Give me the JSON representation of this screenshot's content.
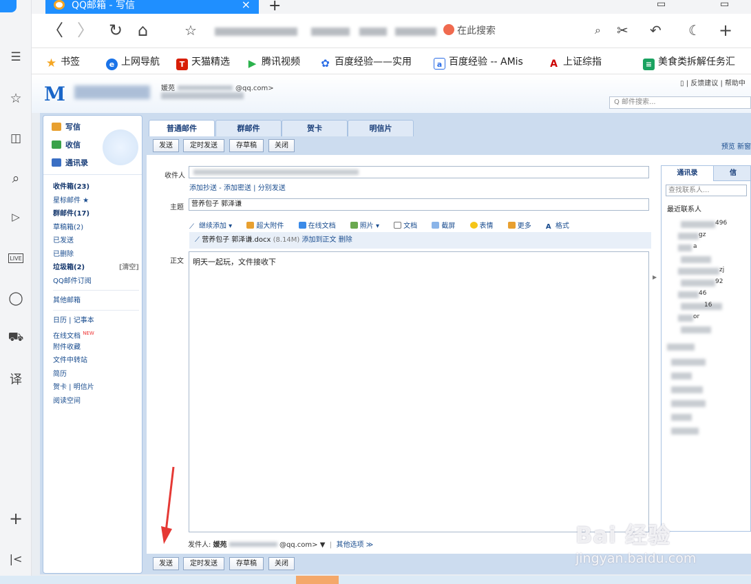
{
  "browser": {
    "tab_title": "QQ邮箱 - 写信",
    "tab_close": "×",
    "new_tab": "+",
    "search_hint": "在此搜索",
    "nav": {
      "back": "〈",
      "forward": "〉",
      "reload": "↻",
      "home": "⌂",
      "star": "☆",
      "search": "⌕",
      "cut": "✂",
      "undo": "↶",
      "moon": "☾",
      "plus": "+"
    }
  },
  "rail": {
    "items": [
      "≡",
      "☆",
      "📖",
      "⌕",
      "▷",
      "LIVE",
      "◯",
      "🛒",
      "译",
      "+",
      "|<"
    ]
  },
  "bookmarks": {
    "items": [
      {
        "label": "书签",
        "icon": "star",
        "color": "#f5a623",
        "glyph": "★"
      },
      {
        "label": "上网导航",
        "icon": "ie",
        "color": "#1a73e8",
        "glyph": "e"
      },
      {
        "label": "天猫精选",
        "icon": "tmall",
        "color": "#d81e06",
        "glyph": "T"
      },
      {
        "label": "腾讯视频",
        "icon": "video",
        "color": "#2bb24c",
        "glyph": "▶"
      },
      {
        "label": "百度经验——实用",
        "icon": "baidu",
        "color": "#2b6de6",
        "glyph": "✿"
      },
      {
        "label": "百度经验 -- AMis",
        "icon": "a",
        "color": "#2b6de6",
        "glyph": "a"
      },
      {
        "label": "上证综指",
        "icon": "stock",
        "color": "#c00",
        "glyph": "A"
      },
      {
        "label": "美食类拆解任务汇",
        "icon": "sheet",
        "color": "#1aa260",
        "glyph": "≡"
      }
    ]
  },
  "mail_header": {
    "logo": "M",
    "account_line": "媛苑",
    "account_email": "@qq.com>",
    "top_links": "▯ | 反馈建议 | 帮助中",
    "search_placeholder": "Q 邮件搜索..."
  },
  "sidebar": {
    "top": [
      {
        "label": "写信",
        "color": "#e8a030"
      },
      {
        "label": "收信",
        "color": "#3aa24a"
      },
      {
        "label": "通讯录",
        "color": "#3a6fc4"
      }
    ],
    "items": [
      {
        "label": "收件箱(23)",
        "bold": true
      },
      {
        "label": "星标邮件 ★",
        "bold": false
      },
      {
        "label": "群邮件(17)",
        "bold": true
      },
      {
        "label": "草稿箱(2)",
        "bold": false
      },
      {
        "label": "已发送",
        "bold": false
      },
      {
        "label": "已删除",
        "bold": false
      },
      {
        "label": "垃圾箱(2)",
        "bold": true,
        "right": "[清空]"
      },
      {
        "label": "QQ邮件订阅",
        "bold": false
      }
    ],
    "items2": [
      "其他邮箱"
    ],
    "items3": [
      {
        "label": "日历 | 记事本"
      },
      {
        "label": "在线文档",
        "new": "NEW"
      },
      {
        "label": "附件收藏"
      },
      {
        "label": "文件中转站"
      },
      {
        "label": "简历"
      },
      {
        "label": "贺卡 | 明信片"
      },
      {
        "label": "阅读空间"
      }
    ]
  },
  "compose": {
    "tabs": [
      "普通邮件",
      "群邮件",
      "贺卡",
      "明信片"
    ],
    "buttons": {
      "send": "发送",
      "timed_send": "定时发送",
      "save_draft": "存草稿",
      "close": "关闭"
    },
    "toolbar_right": "预览  新窗",
    "recipient_label": "收件人",
    "cc_links": "添加抄送 - 添加密送 | 分别发送",
    "subject_label": "主题",
    "subject_value": "营养包子 郭泽谦",
    "attach_tools": [
      "继续添加 ▾",
      "超大附件",
      "在线文档",
      "照片 ▾",
      "文档",
      "截屏",
      "表情",
      "更多",
      "格式"
    ],
    "attachment": {
      "name": "营养包子 郭泽谦.docx",
      "size": "(8.14M)",
      "add_to_body": "添加到正文",
      "delete": "删除"
    },
    "body_label": "正文",
    "body_text": "明天一起玩，文件接收下",
    "sender_label": "发件人:",
    "sender_value": "媛苑",
    "sender_email": "@qq.com> ▼",
    "other_options": "其他选项 ≫"
  },
  "contacts": {
    "tabs": [
      "通讯录",
      "信"
    ],
    "search_placeholder": "查找联系人...",
    "recent_label": "最近联系人",
    "entries": [
      "496",
      "gz",
      "a",
      "",
      "zj",
      "92",
      "46",
      "16",
      "or",
      ""
    ]
  },
  "watermark": {
    "line1": "Bai 经验",
    "line2": "jingyan.baidu.com"
  }
}
